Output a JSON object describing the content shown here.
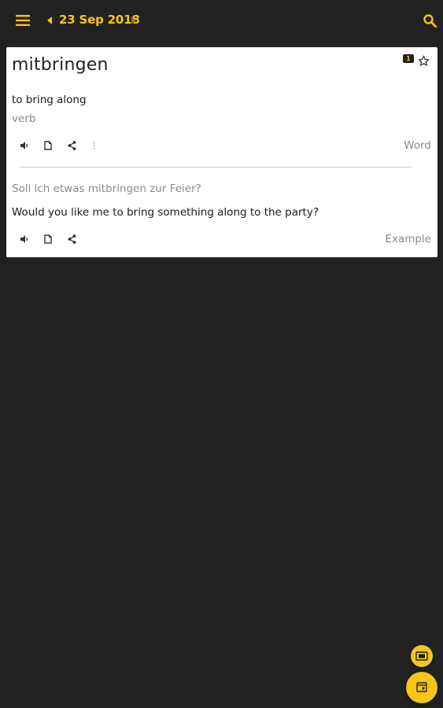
{
  "header": {
    "menu_icon": "hamburger-menu-icon",
    "prev_icon": "caret-left-icon",
    "date": "23 Sep 2018",
    "next_icon": "caret-right-icon",
    "search_icon": "search-icon",
    "accent_color": "#f5c518",
    "background_color": "#222222"
  },
  "card": {
    "word": "mitbringen",
    "badge": "1",
    "favorite_icon": "star-outline-icon",
    "translation": "to bring along",
    "part_of_speech": "verb",
    "word_actions": [
      "speaker-icon",
      "copy-icon",
      "share-icon",
      "more-vertical-icon"
    ],
    "word_label": "Word",
    "example_german": "Soll ich etwas mitbringen zur Feier?",
    "example_english": "Would you like me to bring something along to the party?",
    "example_actions": [
      "speaker-icon",
      "copy-icon",
      "share-icon"
    ],
    "example_label": "Example"
  },
  "fabs": {
    "small_icon": "flashcards-icon",
    "large_icon": "calendar-icon"
  }
}
